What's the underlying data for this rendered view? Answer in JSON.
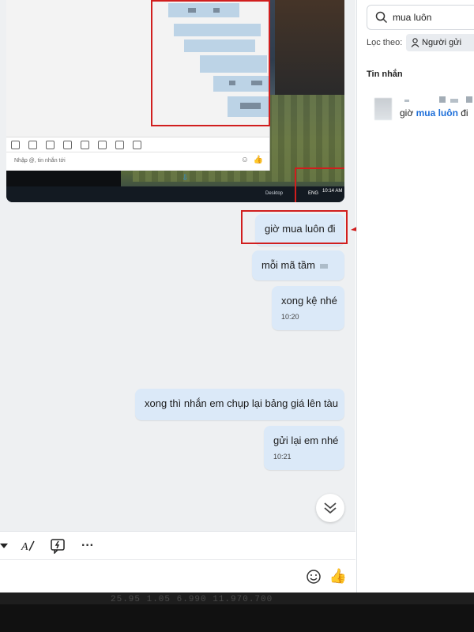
{
  "screenshot": {
    "input_placeholder": "Nhập @, tin nhắn tới",
    "taskbar_desktop": "Desktop",
    "taskbar_lang": "ENG",
    "taskbar_time": "10:14 AM"
  },
  "messages": [
    {
      "text": "giờ mua luôn đi",
      "time": ""
    },
    {
      "text": "mỗi mã tầm",
      "time": ""
    },
    {
      "text": "xong kệ nhé",
      "time": "10:20"
    },
    {
      "text": "xong thì nhắn em chụp lại bảng giá lên tàu",
      "time": ""
    },
    {
      "text": "gửi lại em nhé",
      "time": "10:21"
    }
  ],
  "toolbar": {
    "icons": [
      "chevron-down-icon",
      "text-format-icon",
      "quick-message-icon",
      "more-icon"
    ],
    "more_label": "···"
  },
  "composer": {
    "emoji_icon": "emoji-icon",
    "like_icon": "thumbs-up-icon"
  },
  "sidebar": {
    "search_value": "mua luôn",
    "filter_label": "Lọc theo:",
    "filter_chip": "Người gửi",
    "section_title": "Tin nhắn",
    "result_prefix": "giờ",
    "result_match": "mua luôn",
    "result_suffix": "đi"
  },
  "bottom_strip": {
    "numbers": "25.95      1.05      6.990    11.970.700"
  },
  "colors": {
    "bubble": "#dbe9f8",
    "highlight_red": "#d11e1e",
    "match_blue": "#1e6fd9"
  }
}
